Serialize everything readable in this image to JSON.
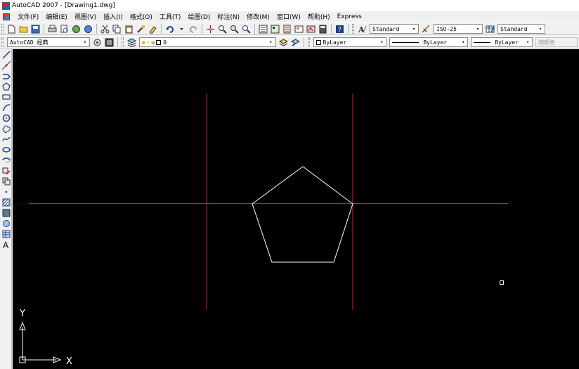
{
  "window": {
    "title": "AutoCAD 2007 - [Drawing1.dwg]"
  },
  "menu": [
    {
      "key": "file",
      "label": "文件(F)"
    },
    {
      "key": "edit",
      "label": "编辑(E)"
    },
    {
      "key": "view",
      "label": "视图(V)"
    },
    {
      "key": "insert",
      "label": "插入(I)"
    },
    {
      "key": "format",
      "label": "格式(O)"
    },
    {
      "key": "tools",
      "label": "工具(T)"
    },
    {
      "key": "draw",
      "label": "绘图(D)"
    },
    {
      "key": "dimension",
      "label": "标注(N)"
    },
    {
      "key": "modify",
      "label": "修改(M)"
    },
    {
      "key": "window",
      "label": "窗口(W)"
    },
    {
      "key": "help",
      "label": "帮助(H)"
    },
    {
      "key": "express",
      "label": "Express"
    }
  ],
  "styles": {
    "text_style": "Standard",
    "dim_style": "ISO-25",
    "table_style": "Standard"
  },
  "workspace": "AutoCAD 经典",
  "layer": {
    "name": "0"
  },
  "properties": {
    "color": "ByLayer",
    "linetype": "ByLayer",
    "lineweight": "ByLayer",
    "plot_style": "随颜色"
  },
  "canvas": {
    "background": "#000000",
    "axis_y": "Y",
    "axis_x": "X"
  },
  "colors": {
    "construction_lines": "#d42121",
    "polygon": "#ffffff"
  },
  "icons": {
    "standard_toolbar": [
      "new-icon",
      "open-icon",
      "save-icon",
      "plot-icon",
      "plot-preview-icon",
      "publish-icon",
      "3d-dwf-icon",
      "cut-icon",
      "copy-icon",
      "paste-icon",
      "match-properties-icon",
      "block-editor-icon",
      "undo-icon",
      "redo-icon",
      "pan-icon",
      "zoom-realtime-icon",
      "zoom-window-icon",
      "zoom-previous-icon",
      "properties-icon",
      "design-center-icon",
      "tool-palettes-icon",
      "sheet-set-icon",
      "markup-icon",
      "quickcalc-icon",
      "help-icon"
    ],
    "draw_toolbar": [
      "line-icon",
      "construction-line-icon",
      "polyline-icon",
      "polygon-icon",
      "rectangle-icon",
      "arc-icon",
      "circle-icon",
      "revision-cloud-icon",
      "spline-icon",
      "ellipse-icon",
      "ellipse-arc-icon",
      "insert-block-icon",
      "make-block-icon",
      "point-icon",
      "hatch-icon",
      "gradient-icon",
      "region-icon",
      "table-icon",
      "multiline-text-icon"
    ]
  }
}
